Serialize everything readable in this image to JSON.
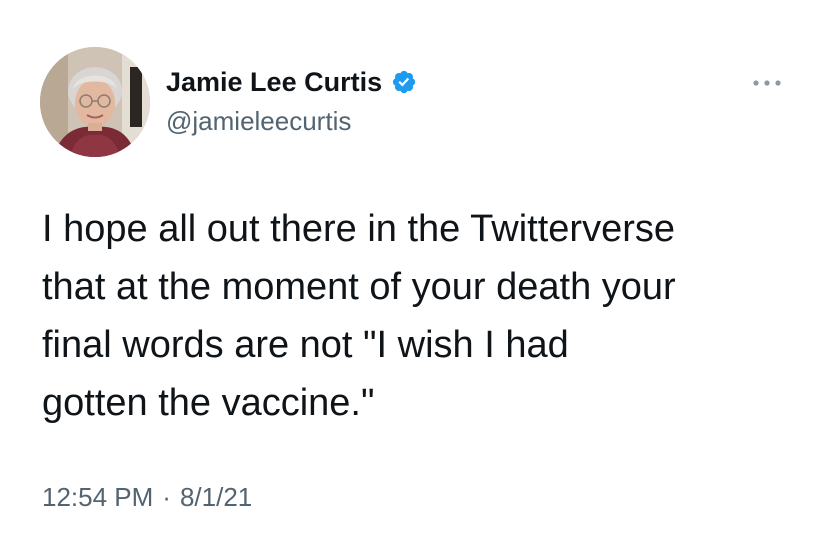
{
  "tweet": {
    "author": {
      "display_name": "Jamie Lee Curtis",
      "handle": "@jamieleecurtis",
      "verified": true,
      "verified_icon": "verified-badge-icon",
      "avatar_icon": "profile-photo"
    },
    "more_icon": "more-options-icon",
    "text_lines": [
      "I hope all out there in the Twitterverse",
      "that at the moment of your death your",
      "final words are not \"I wish I had",
      "gotten the vaccine.\""
    ],
    "time": "12:54 PM",
    "separator": "·",
    "date": "8/1/21"
  },
  "colors": {
    "background": "#ffffff",
    "primary_text": "#0f1419",
    "secondary_text": "#536471",
    "verified_blue": "#1d9bf0"
  }
}
